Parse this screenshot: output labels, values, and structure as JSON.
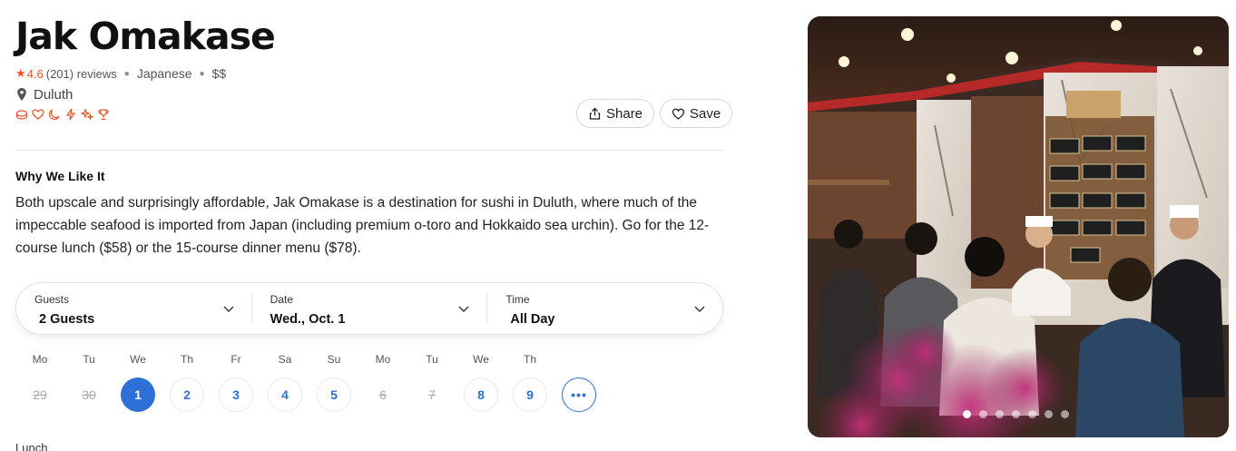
{
  "restaurant": {
    "name": "Jak Omakase",
    "rating": "4.6",
    "reviews": "(201) reviews",
    "cuisine": "Japanese",
    "price": "$$",
    "location": "Duluth",
    "tag_icons": [
      "sushi-icon",
      "heart-leaf-icon",
      "moon-icon",
      "bolt-icon",
      "sparkles-icon",
      "trophy-icon"
    ]
  },
  "actions": {
    "share": "Share",
    "save": "Save"
  },
  "why": {
    "heading": "Why We Like It",
    "text": "Both upscale and surprisingly affordable, Jak Omakase is a destination for sushi in Duluth, where much of the impeccable seafood is imported from Japan (including premium o-toro and Hokkaido sea urchin). Go for the 12-course lunch ($58) or the 15-course dinner menu ($78)."
  },
  "booking": {
    "guests_label": "Guests",
    "guests_value": "2 Guests",
    "date_label": "Date",
    "date_value": "Wed., Oct. 1",
    "time_label": "Time",
    "time_value": "All Day"
  },
  "days": [
    {
      "name": "Mo",
      "num": "29",
      "state": "off"
    },
    {
      "name": "Tu",
      "num": "30",
      "state": "off"
    },
    {
      "name": "We",
      "num": "1",
      "state": "selected"
    },
    {
      "name": "Th",
      "num": "2",
      "state": "available"
    },
    {
      "name": "Fr",
      "num": "3",
      "state": "available"
    },
    {
      "name": "Sa",
      "num": "4",
      "state": "available"
    },
    {
      "name": "Su",
      "num": "5",
      "state": "available"
    },
    {
      "name": "Mo",
      "num": "6",
      "state": "off"
    },
    {
      "name": "Tu",
      "num": "7",
      "state": "off"
    },
    {
      "name": "We",
      "num": "8",
      "state": "available"
    },
    {
      "name": "Th",
      "num": "9",
      "state": "available"
    }
  ],
  "more_dates": "•••",
  "section_label": "Lunch",
  "carousel": {
    "total": 7,
    "active": 1
  },
  "colors": {
    "accent": "#2f6fd8",
    "rating": "#e8542a"
  }
}
